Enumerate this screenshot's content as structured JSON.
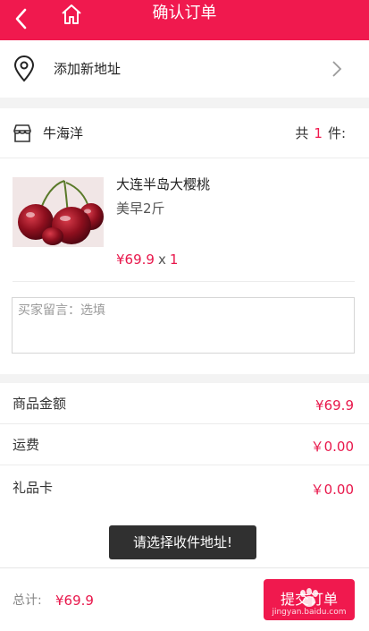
{
  "header": {
    "title": "确认订单",
    "back_icon": "chevron-left-icon",
    "home_icon": "home-icon"
  },
  "address": {
    "label": "添加新地址",
    "icon": "location-pin-icon"
  },
  "shop": {
    "name": "牛海洋",
    "count_prefix": "共",
    "count": "1",
    "count_suffix": "件:"
  },
  "product": {
    "name": "大连半岛大樱桃",
    "spec": "美早2斤",
    "price": "¥69.9",
    "times": "x",
    "qty": "1"
  },
  "note": {
    "placeholder": "买家留言：选填",
    "value": ""
  },
  "summary": [
    {
      "label": "商品金额",
      "value": "¥69.9"
    },
    {
      "label": "运费",
      "value": "￥0.00"
    },
    {
      "label": "礼品卡",
      "value": "￥0.00"
    }
  ],
  "toast": "请选择收件地址!",
  "footer": {
    "total_label": "总计:",
    "total_value": "¥69.9",
    "submit_label": "提交订单",
    "watermark_url": "jingyan.baidu.com"
  },
  "colors": {
    "accent": "#f0194e",
    "price": "#e8174b",
    "divider": "#f3f3f3"
  }
}
